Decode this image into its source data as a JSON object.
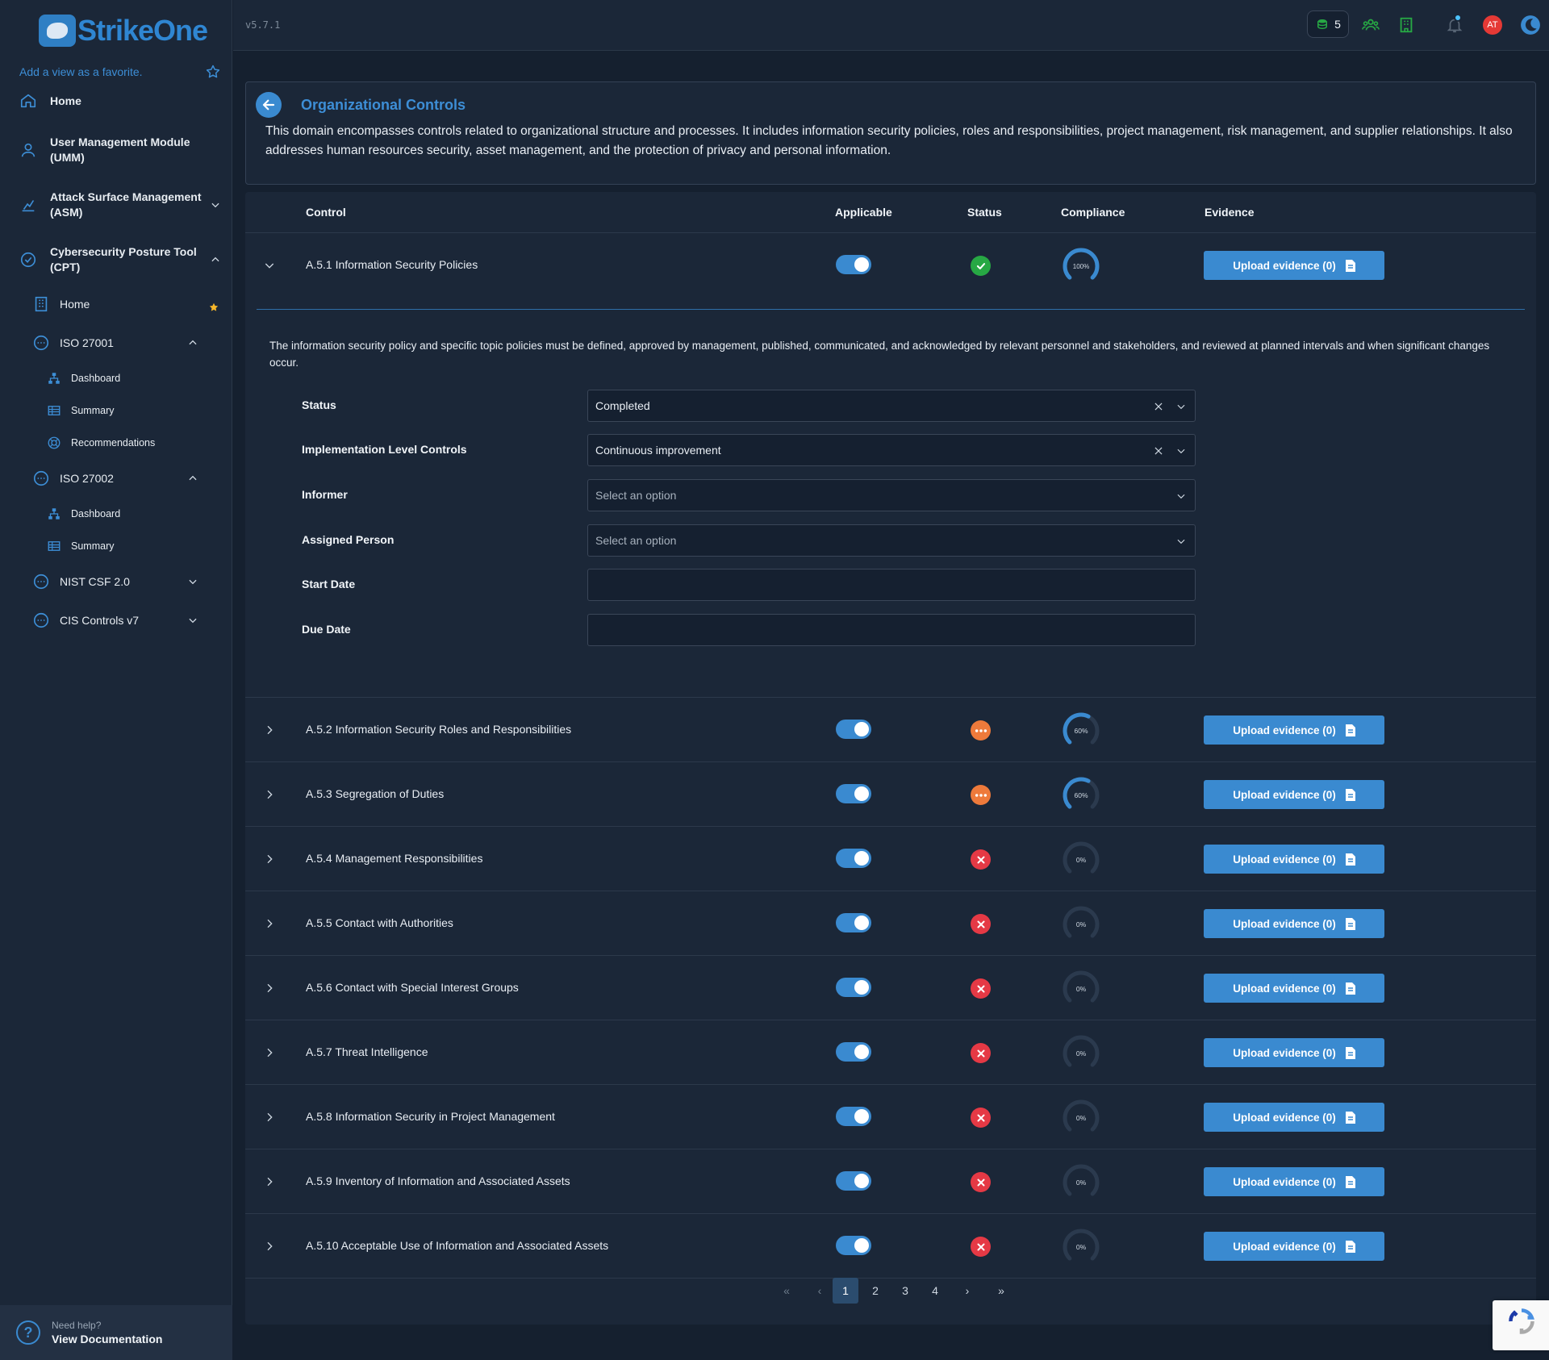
{
  "app": {
    "name": "StrikeOne",
    "version": "v5.7.1"
  },
  "sidebar": {
    "favorite_hint": "Add a view as a favorite.",
    "items": [
      {
        "label": "Home"
      },
      {
        "label": "User Management Module (UMM)"
      },
      {
        "label": "Attack Surface Management (ASM)"
      },
      {
        "label": "Cybersecurity Posture Tool (CPT)"
      }
    ],
    "cpt": {
      "home": "Home",
      "iso27001": {
        "label": "ISO 27001",
        "children": [
          "Dashboard",
          "Summary",
          "Recommendations"
        ]
      },
      "iso27002": {
        "label": "ISO 27002",
        "children": [
          "Dashboard",
          "Summary"
        ]
      },
      "nist": "NIST CSF 2.0",
      "cis": "CIS Controls v7"
    },
    "help": {
      "line1": "Need help?",
      "line2": "View Documentation"
    }
  },
  "topbar": {
    "coins": "5",
    "avatar_initials": "AT"
  },
  "domain": {
    "title": "Organizational Controls",
    "description": "This domain encompasses controls related to organizational structure and processes. It includes information security policies, roles and responsibilities, project management, risk management, and supplier relationships. It also addresses human resources security, asset management, and the protection of privacy and personal information."
  },
  "table": {
    "headers": {
      "control": "Control",
      "applicable": "Applicable",
      "status": "Status",
      "compliance": "Compliance",
      "evidence": "Evidence"
    },
    "expanded": {
      "description": "The information security policy and specific topic policies must be defined, approved by management, published, communicated, and acknowledged by relevant personnel and stakeholders, and reviewed at planned intervals and when significant changes occur.",
      "fields": [
        {
          "label": "Status",
          "value": "Completed",
          "clearable": true
        },
        {
          "label": "Implementation Level Controls",
          "value": "Continuous improvement",
          "clearable": true
        },
        {
          "label": "Informer",
          "value": "Select an option",
          "placeholder": true
        },
        {
          "label": "Assigned Person",
          "value": "Select an option",
          "placeholder": true
        },
        {
          "label": "Start Date",
          "value": ""
        },
        {
          "label": "Due Date",
          "value": ""
        }
      ]
    },
    "rows": [
      {
        "name": "A.5.1 Information Security Policies",
        "status": "ok",
        "compliance": 100,
        "compliance_label": "100%",
        "evidence": "Upload evidence (0)"
      },
      {
        "name": "A.5.2 Information Security Roles and Responsibilities",
        "status": "prog",
        "compliance": 60,
        "compliance_label": "60%",
        "evidence": "Upload evidence (0)"
      },
      {
        "name": "A.5.3 Segregation of Duties",
        "status": "prog",
        "compliance": 60,
        "compliance_label": "60%",
        "evidence": "Upload evidence (0)"
      },
      {
        "name": "A.5.4 Management Responsibilities",
        "status": "no",
        "compliance": 0,
        "compliance_label": "0%",
        "evidence": "Upload evidence (0)"
      },
      {
        "name": "A.5.5 Contact with Authorities",
        "status": "no",
        "compliance": 0,
        "compliance_label": "0%",
        "evidence": "Upload evidence (0)"
      },
      {
        "name": "A.5.6 Contact with Special Interest Groups",
        "status": "no",
        "compliance": 0,
        "compliance_label": "0%",
        "evidence": "Upload evidence (0)"
      },
      {
        "name": "A.5.7 Threat Intelligence",
        "status": "no",
        "compliance": 0,
        "compliance_label": "0%",
        "evidence": "Upload evidence (0)"
      },
      {
        "name": "A.5.8 Information Security in Project Management",
        "status": "no",
        "compliance": 0,
        "compliance_label": "0%",
        "evidence": "Upload evidence (0)"
      },
      {
        "name": "A.5.9 Inventory of Information and Associated Assets",
        "status": "no",
        "compliance": 0,
        "compliance_label": "0%",
        "evidence": "Upload evidence (0)"
      },
      {
        "name": "A.5.10 Acceptable Use of Information and Associated Assets",
        "status": "no",
        "compliance": 0,
        "compliance_label": "0%",
        "evidence": "Upload evidence (0)"
      }
    ]
  },
  "pagination": {
    "pages": [
      "1",
      "2",
      "3",
      "4"
    ],
    "current": "1",
    "first": "«",
    "prev": "‹",
    "next": "›",
    "last": "»"
  },
  "colors": {
    "accent": "#3a8ad0",
    "ok": "#27a844",
    "in_progress": "#ee7a3b",
    "not_started": "#e53945",
    "background": "#15202f",
    "panel": "#1b2738"
  }
}
